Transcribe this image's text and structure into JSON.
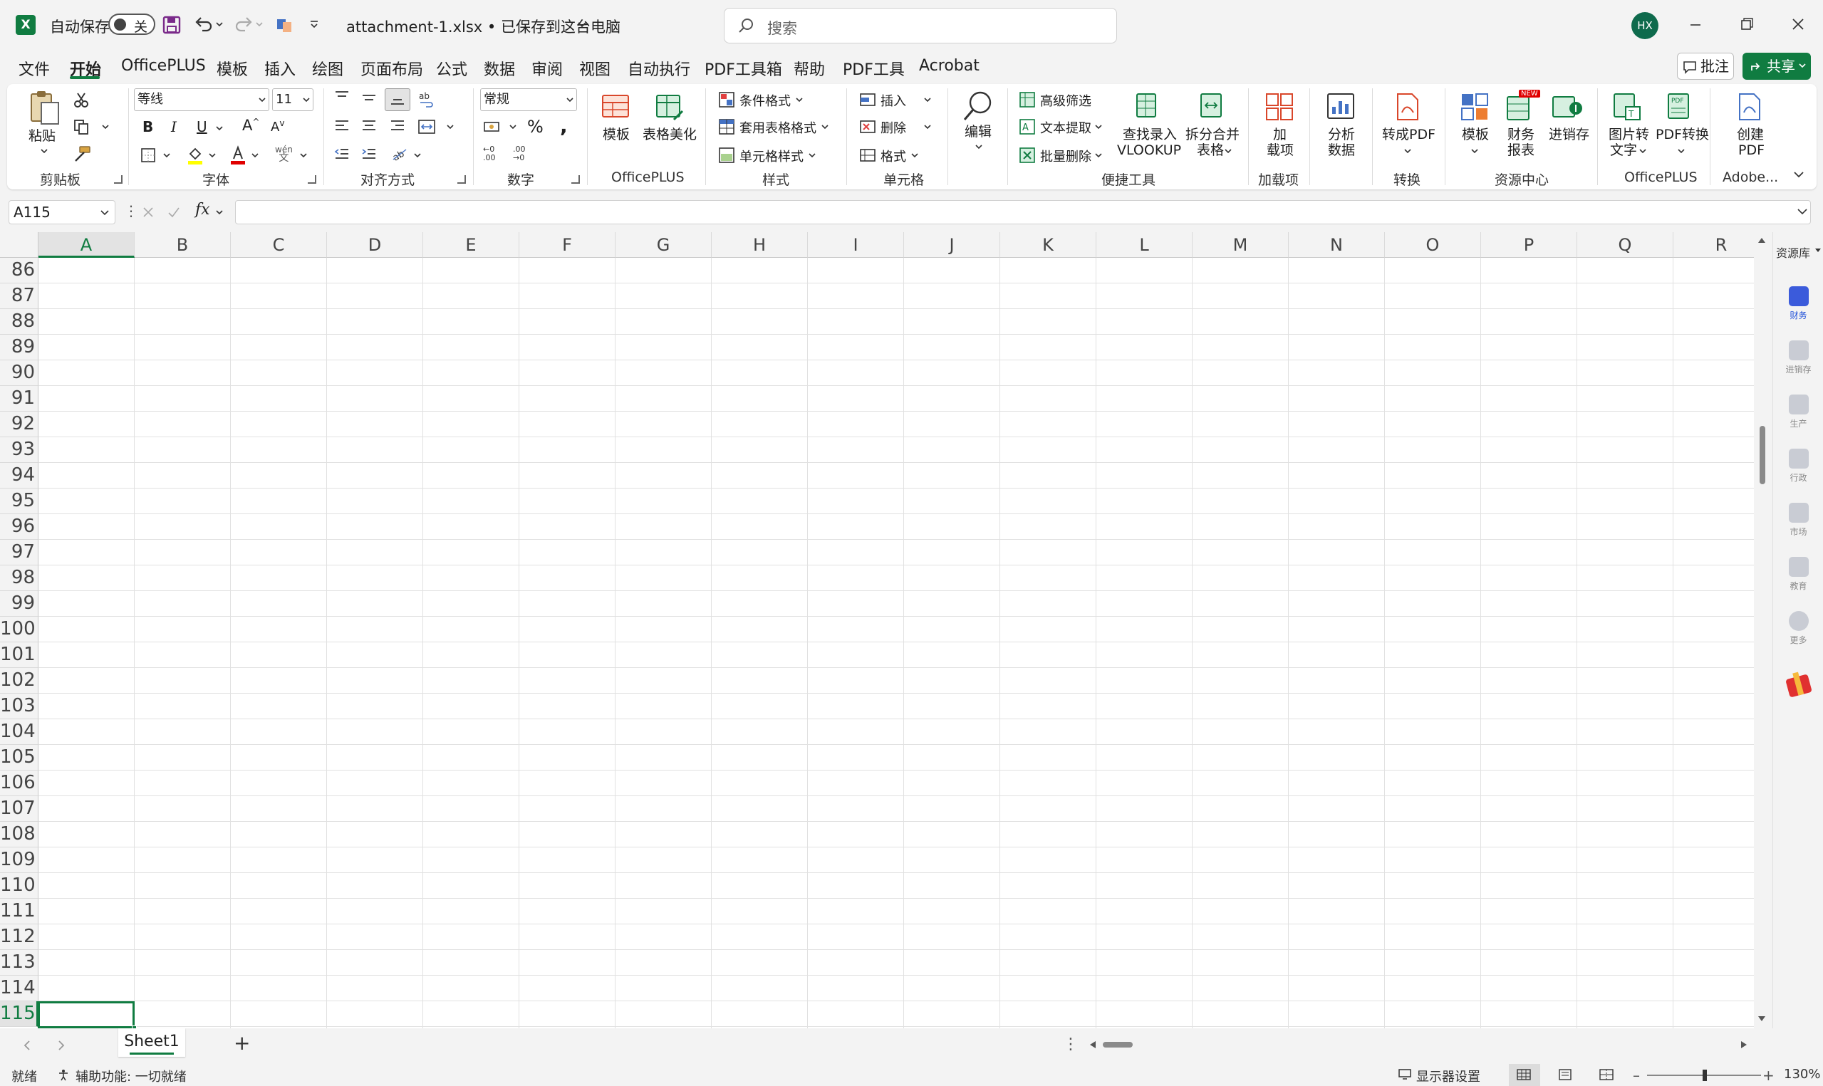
{
  "titlebar": {
    "autosave_label": "自动保存",
    "autosave_state": "关",
    "filename": "attachment-1.xlsx • 已保存到这台电脑",
    "search_placeholder": "搜索",
    "user_initials": "HX"
  },
  "menu": {
    "items": [
      "文件",
      "开始",
      "OfficePLUS",
      "模板",
      "插入",
      "绘图",
      "页面布局",
      "公式",
      "数据",
      "审阅",
      "视图",
      "自动执行",
      "PDF工具箱",
      "帮助",
      "PDF工具",
      "Acrobat"
    ],
    "active": "开始",
    "comment_label": "批注",
    "share_label": "共享"
  },
  "ribbon": {
    "clipboard": {
      "paste": "粘贴",
      "label": "剪贴板"
    },
    "font": {
      "name": "等线",
      "size": "11",
      "label": "字体"
    },
    "alignment": {
      "label": "对齐方式"
    },
    "number": {
      "format": "常规",
      "label": "数字"
    },
    "officeplus1": {
      "template": "模板",
      "beautify": "表格美化",
      "label": "OfficePLUS"
    },
    "styles": {
      "conditional": "条件格式",
      "table_format": "套用表格格式",
      "cell_style": "单元格样式",
      "label": "样式"
    },
    "cells": {
      "insert": "插入",
      "delete": "删除",
      "format": "格式",
      "label": "单元格"
    },
    "editing": {
      "edit": "编辑"
    },
    "quicktools": {
      "advanced_filter": "高级筛选",
      "text_extract": "文本提取",
      "batch_delete": "批量删除",
      "vlookup_line1": "查找录入",
      "vlookup_line2": "VLOOKUP",
      "split_line1": "拆分合并",
      "split_line2": "表格",
      "label": "便捷工具"
    },
    "addins": {
      "line1": "加",
      "line2": "载项",
      "label": "加载项"
    },
    "analyze": {
      "line1": "分析",
      "line2": "数据"
    },
    "convert": {
      "to_pdf": "转成PDF",
      "label": "转换"
    },
    "resources": {
      "template": "模板",
      "finance_line1": "财务",
      "finance_line2": "报表",
      "inventory": "进销存",
      "new_badge": "NEW",
      "label": "资源中心"
    },
    "officeplus2": {
      "img_line1": "图片转",
      "img_line2": "文字",
      "pdf_line1": "PDF转换",
      "label": "OfficePLUS"
    },
    "adobe": {
      "line1": "创建",
      "line2": "PDF",
      "label": "Adobe..."
    }
  },
  "formula_bar": {
    "name_box": "A115",
    "fx": "fx",
    "value": ""
  },
  "grid": {
    "columns": [
      "A",
      "B",
      "C",
      "D",
      "E",
      "F",
      "G",
      "H",
      "I",
      "J",
      "K",
      "L",
      "M",
      "N",
      "O",
      "P",
      "Q",
      "R"
    ],
    "rows": [
      "86",
      "87",
      "88",
      "89",
      "90",
      "91",
      "92",
      "93",
      "94",
      "95",
      "96",
      "97",
      "98",
      "99",
      "100",
      "101",
      "102",
      "103",
      "104",
      "105",
      "106",
      "107",
      "108",
      "109",
      "110",
      "111",
      "112",
      "113",
      "114",
      "115"
    ],
    "selected_column": "A",
    "selected_row": "115"
  },
  "side_panel": {
    "title": "资源库",
    "items": [
      "财务",
      "进销存",
      "生产",
      "行政",
      "市场",
      "教育",
      "更多"
    ],
    "active": "财务"
  },
  "sheets": {
    "tabs": [
      "Sheet1"
    ],
    "active": "Sheet1",
    "add_label": "+"
  },
  "statusbar": {
    "ready": "就绪",
    "accessibility": "辅助功能: 一切就绪",
    "display_settings": "显示器设置",
    "zoom": "130%"
  },
  "colors": {
    "accent": "#107c41",
    "background": "#f3f3f3"
  }
}
